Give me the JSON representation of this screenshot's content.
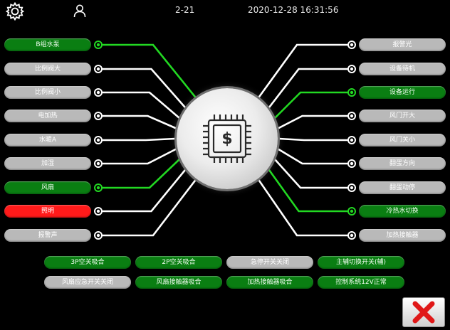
{
  "header": {
    "page_number": "2-21",
    "datetime": "2020-12-28 16:31:56",
    "settings_icon": "gear-icon",
    "user_icon": "user-icon"
  },
  "left_signals": [
    {
      "label": "B组水泵",
      "state": "on"
    },
    {
      "label": "比例阀大",
      "state": "off"
    },
    {
      "label": "比例阀小",
      "state": "off"
    },
    {
      "label": "电加热",
      "state": "off"
    },
    {
      "label": "水暖A",
      "state": "off"
    },
    {
      "label": "加湿",
      "state": "off"
    },
    {
      "label": "风扇",
      "state": "on"
    },
    {
      "label": "照明",
      "state": "alarm"
    },
    {
      "label": "报警声",
      "state": "off"
    }
  ],
  "right_signals": [
    {
      "label": "报警光",
      "state": "off"
    },
    {
      "label": "设备待机",
      "state": "off"
    },
    {
      "label": "设备运行",
      "state": "on"
    },
    {
      "label": "风门开大",
      "state": "off"
    },
    {
      "label": "风门关小",
      "state": "off"
    },
    {
      "label": "翻蛋方向",
      "state": "off"
    },
    {
      "label": "翻蛋动停",
      "state": "off"
    },
    {
      "label": "冷热水切换",
      "state": "on"
    },
    {
      "label": "加热接触器",
      "state": "off"
    }
  ],
  "bottom_signals": [
    {
      "label": "3P空关吸合",
      "state": "on"
    },
    {
      "label": "2P空关吸合",
      "state": "on"
    },
    {
      "label": "急停开关关闭",
      "state": "off"
    },
    {
      "label": "主辅切换开关(辅)",
      "state": "on"
    },
    {
      "label": "风扇应急开关关闭",
      "state": "off"
    },
    {
      "label": "风扇接触器吸合",
      "state": "on"
    },
    {
      "label": "加热接触器吸合",
      "state": "on"
    },
    {
      "label": "控制系统12V正常",
      "state": "on"
    }
  ],
  "center_icon": "cpu-chip-dollar-icon",
  "close_icon": "close-icon",
  "colors": {
    "on": "#0a7e12",
    "off": "#b9b9b9",
    "alarm": "#ff1a1a",
    "wire_on": "#22d822",
    "wire_off": "#ffffff",
    "background": "#000000"
  }
}
